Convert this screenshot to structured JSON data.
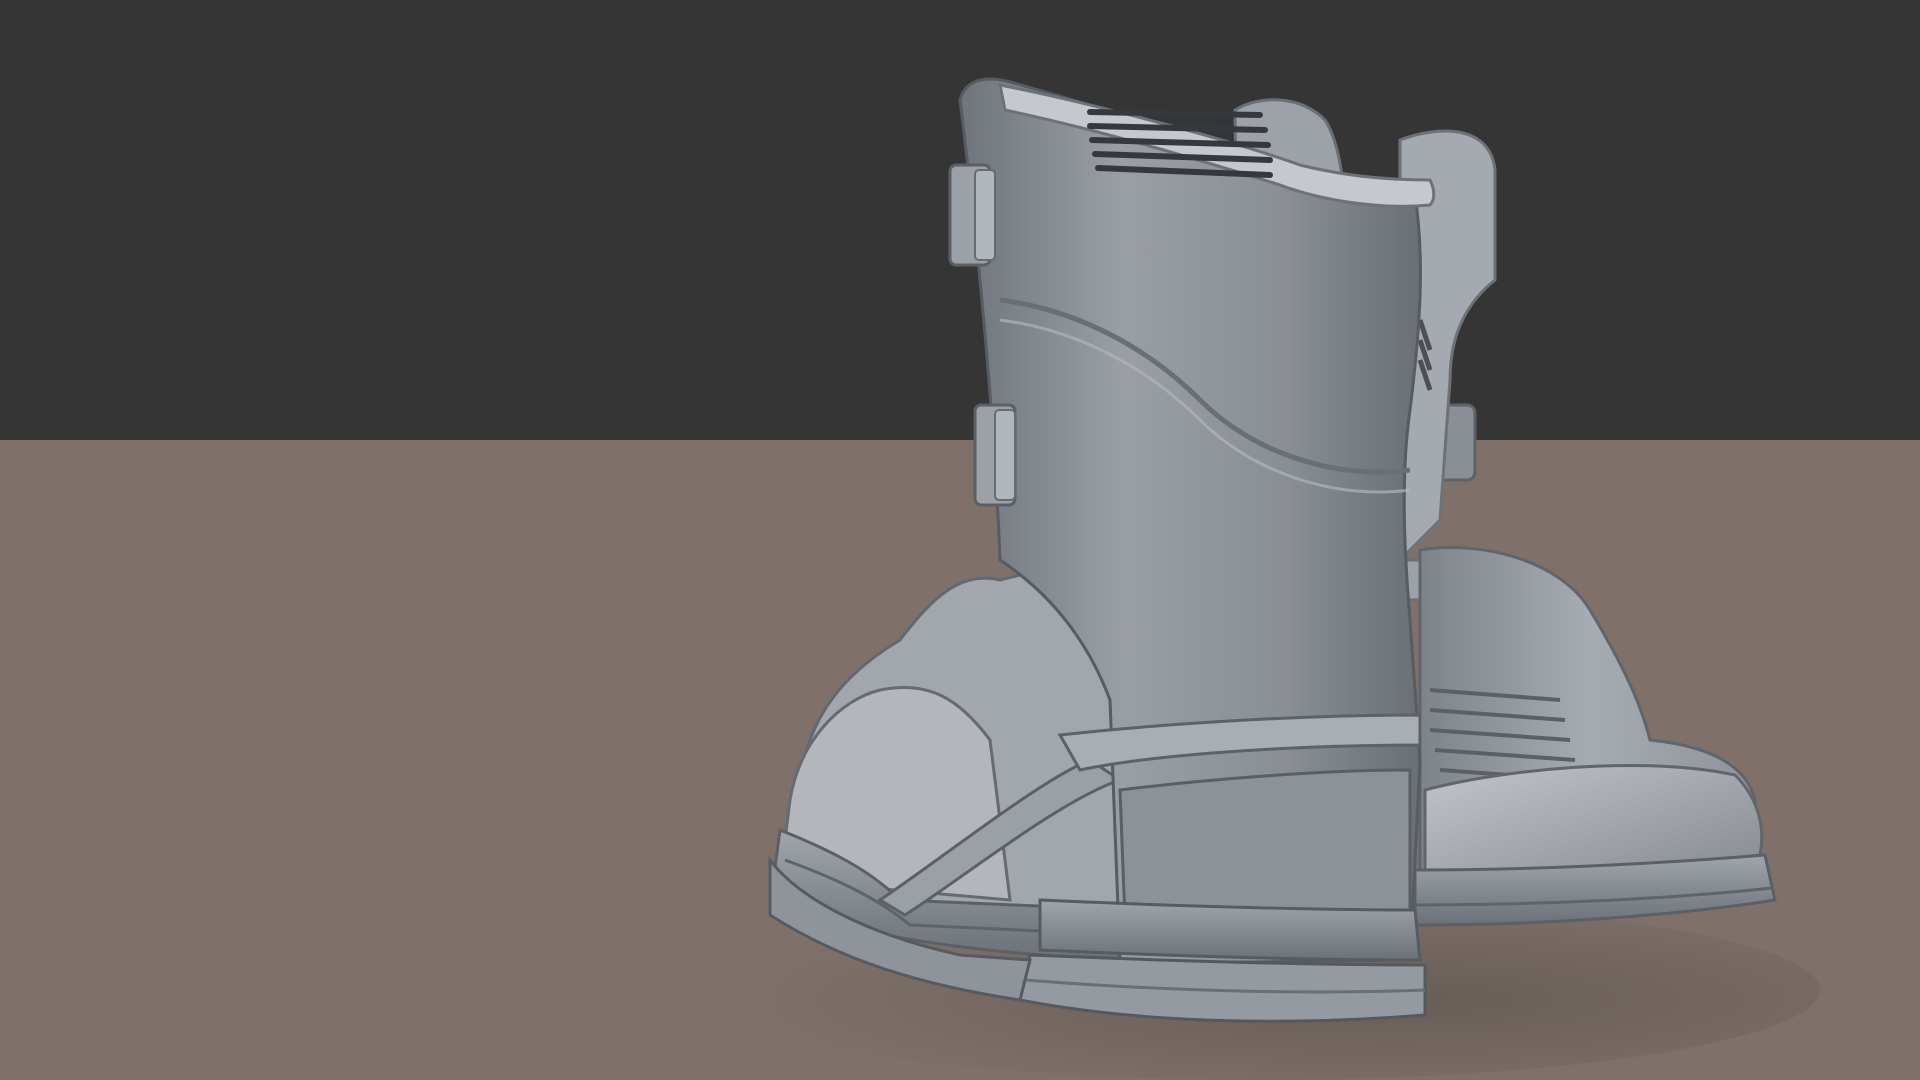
{
  "scene": {
    "subject": "boots-render",
    "colors": {
      "backdrop": "#353535",
      "floor": "#7f716a",
      "boot_light": "#b4b8bd",
      "boot_mid": "#8f949a",
      "boot_dark": "#5d6268",
      "boot_shadow": "#3c3f44"
    }
  }
}
